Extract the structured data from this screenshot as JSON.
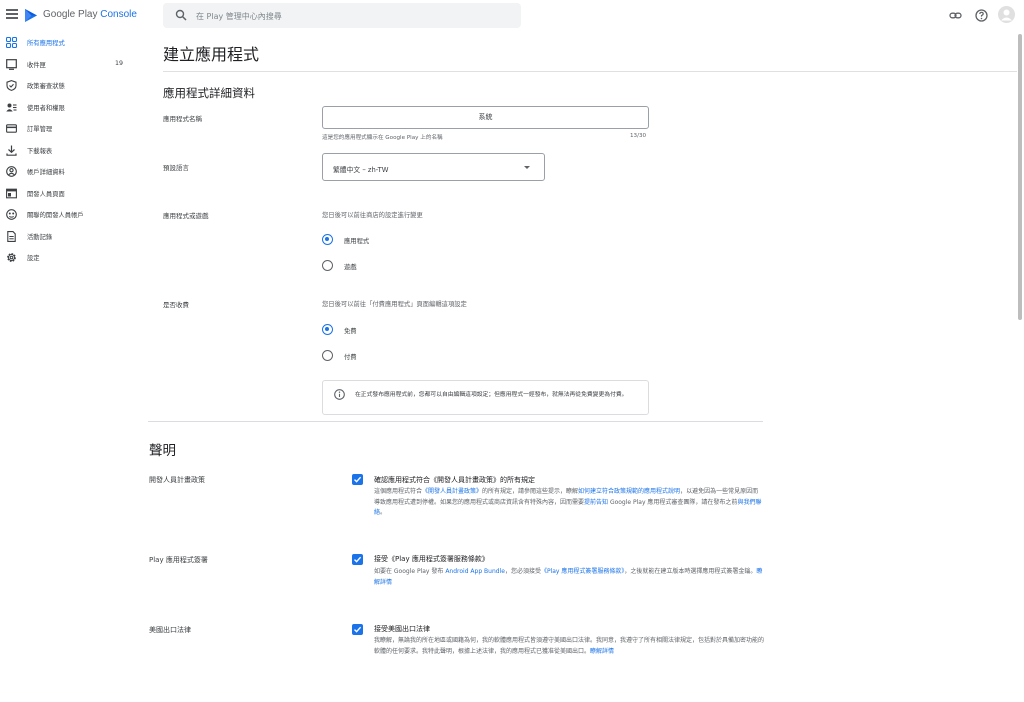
{
  "brand": {
    "google_play": "Google Play",
    "console": "Console"
  },
  "search": {
    "placeholder": "在 Play 管理中心內搜尋"
  },
  "sidebar": {
    "items": [
      {
        "label": "所有應用程式",
        "active": true,
        "icon": "apps-grid-icon"
      },
      {
        "label": "收件匣",
        "count": "19",
        "icon": "inbox-icon"
      },
      {
        "label": "政策審查狀態",
        "icon": "shield-check-icon"
      },
      {
        "label": "使用者和權限",
        "icon": "people-icon"
      },
      {
        "label": "訂單管理",
        "icon": "credit-card-icon"
      },
      {
        "label": "下載報表",
        "icon": "download-icon"
      },
      {
        "label": "帳戶詳細資料",
        "icon": "account-circle-icon"
      },
      {
        "label": "開發人員頁面",
        "icon": "web-page-icon"
      },
      {
        "label": "關聯的開發人員帳戶",
        "icon": "linked-accounts-icon"
      },
      {
        "label": "活動記錄",
        "icon": "document-icon"
      },
      {
        "label": "設定",
        "icon": "settings-gear-icon"
      }
    ]
  },
  "page": {
    "title": "建立應用程式",
    "section_title": "應用程式詳細資料"
  },
  "form": {
    "app_name_label": "應用程式名稱",
    "app_name_value": "系統",
    "app_name_hint": "這是您的應用程式顯示在 Google Play 上的名稱",
    "app_name_counter": "13/30",
    "default_lang_label": "預設語言",
    "default_lang_value": "繁體中文 – zh-TW",
    "app_or_game_label": "應用程式或遊戲",
    "app_or_game_hint": "您日後可以前往商店的設定進行變更",
    "app_option": "應用程式",
    "game_option": "遊戲",
    "paid_label": "是否收費",
    "paid_hint": "您日後可以前往「付費應用程式」頁面編輯這項設定",
    "free_option": "免費",
    "paid_option": "付費",
    "info_text": "在正式發布應用程式前，您都可以自由編輯這項設定；但應用程式一經發布，就無法再從免費變更為付費。"
  },
  "declarations": {
    "title": "聲明",
    "items": [
      {
        "label": "開發人員計畫政策",
        "heading": "確認應用程式符合《開發人員計畫政策》的所有規定",
        "body_1": "這個應用程式符合",
        "link_1": "《開發人員計畫政策》",
        "body_2": "的所有規定，請參閱這些提示，瞭解",
        "link_2": "如何建立符合政策規範的應用程式說明",
        "body_3": "，以避免因為一些常見原因而導致應用程式遭到停權。如果您的應用程式或商店資訊含有特殊內容，因而需要",
        "link_3": "提前告知",
        "body_4": " Google Play 應用程式審查團隊，請在發布之前",
        "link_4": "與我們聯絡",
        "body_5": "。"
      },
      {
        "label": "Play 應用程式簽署",
        "heading": "接受《Play 應用程式簽署服務條款》",
        "body_1": "如要在 Google Play 發布 ",
        "link_1": "Android App Bundle",
        "body_2": "，您必須接受",
        "link_2": "《Play 應用程式簽署服務條款》",
        "body_3": "，之後就能在建立版本時選擇應用程式簽署金鑰。",
        "link_3": "瞭解詳情"
      },
      {
        "label": "美國出口法律",
        "heading": "接受美國出口法律",
        "body_1": "我瞭解，無論我的所在地區或國籍為何，我的軟體應用程式皆須遵守美國出口法律。我同意，我遵守了所有相關法律規定，包括對於具備加密功能的軟體的任何要求。我特此聲明，根據上述法律，我的應用程式已獲准從美國出口。",
        "link_1": "瞭解詳情"
      }
    ]
  },
  "colors": {
    "accent": "#1a73e8",
    "text": "#202124",
    "muted": "#5f6368"
  }
}
